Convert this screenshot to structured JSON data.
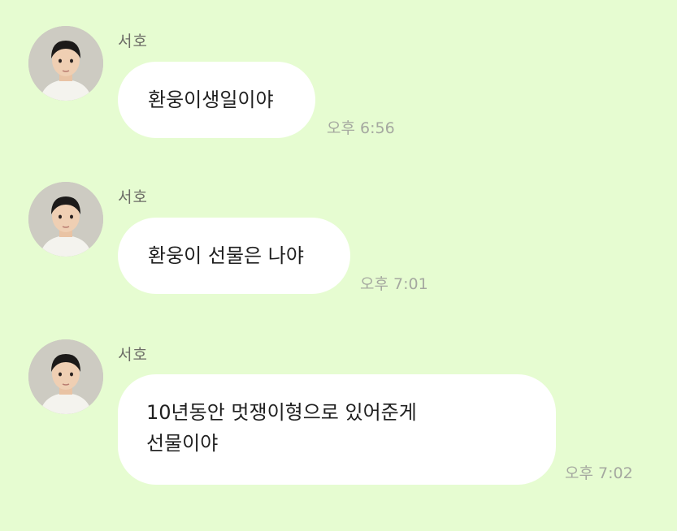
{
  "colors": {
    "background": "#e6fcd1",
    "bubble": "#ffffff",
    "sender_text": "#6c6c66",
    "time_text": "#a5a8a0"
  },
  "messages": [
    {
      "sender": "서호",
      "avatar_icon": "child-portrait-avatar",
      "text": "환웅이생일이야",
      "time": "오후 6:56"
    },
    {
      "sender": "서호",
      "avatar_icon": "child-portrait-avatar",
      "text": "환웅이 선물은 나야",
      "time": "오후 7:01"
    },
    {
      "sender": "서호",
      "avatar_icon": "child-portrait-avatar",
      "text": "10년동안 멋쟁이형으로 있어준게\n선물이야",
      "time": "오후 7:02"
    }
  ]
}
